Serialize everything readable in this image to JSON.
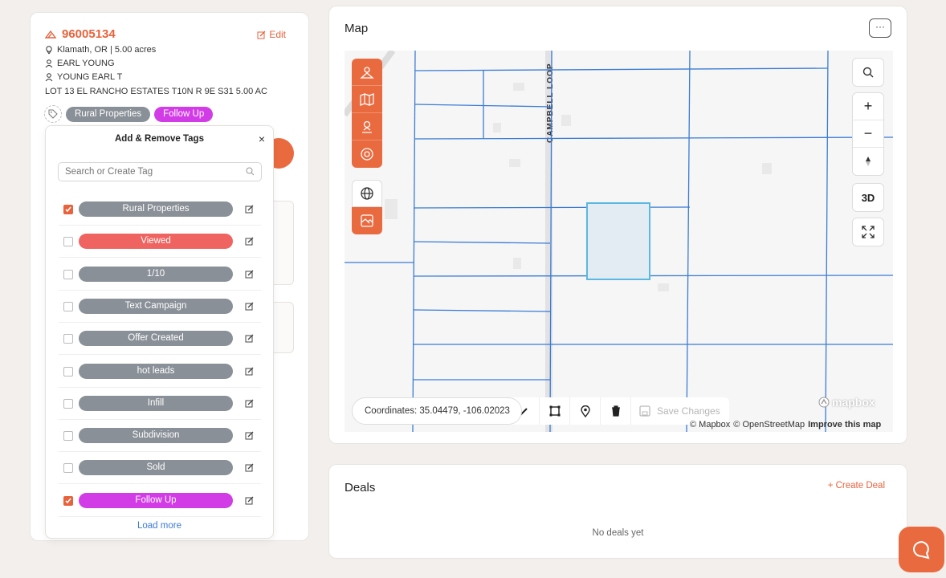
{
  "property": {
    "id": "96005134",
    "edit_label": "Edit",
    "location": "Klamath, OR | 5.00 acres",
    "owner_1": "EARL YOUNG",
    "owner_2": "YOUNG EARL T",
    "legal": "LOT 13 EL RANCHO ESTATES T10N R 9E S31 5.00 AC",
    "tags": [
      "Rural Properties",
      "Follow Up"
    ]
  },
  "tag_popup": {
    "title": "Add & Remove Tags",
    "search_placeholder": "Search or Create Tag",
    "items": [
      {
        "label": "Rural Properties",
        "checked": true,
        "color": "#8a9098"
      },
      {
        "label": "Viewed",
        "checked": false,
        "color": "#ef6461"
      },
      {
        "label": "1/10",
        "checked": false,
        "color": "#8a9098"
      },
      {
        "label": "Text Campaign",
        "checked": false,
        "color": "#8a9098"
      },
      {
        "label": "Offer Created",
        "checked": false,
        "color": "#8a9098"
      },
      {
        "label": "hot leads",
        "checked": false,
        "color": "#8a9098"
      },
      {
        "label": "Infill",
        "checked": false,
        "color": "#8a9098"
      },
      {
        "label": "Subdivision",
        "checked": false,
        "color": "#8a9098"
      },
      {
        "label": "Sold",
        "checked": false,
        "color": "#8a9098"
      },
      {
        "label": "Follow Up",
        "checked": true,
        "color": "#d13ce6"
      }
    ],
    "load_more": "Load more"
  },
  "map": {
    "title": "Map",
    "more": "···",
    "street_label": "CAMPBELL LOOP",
    "coordinates": "Coordinates: 35.04479, -106.02023",
    "save_changes": "Save Changes",
    "three_d": "3D",
    "zoom_in": "+",
    "zoom_out": "−",
    "attribution_1": "© Mapbox",
    "attribution_2": "© OpenStreetMap",
    "attribution_3": "Improve this map",
    "logo": "mapbox"
  },
  "deals": {
    "title": "Deals",
    "create_label": "+ Create Deal",
    "empty": "No deals yet"
  },
  "colors": {
    "accent": "#e8623c",
    "parcel_line": "#3a7bd5",
    "highlight": "#5bb8e0"
  }
}
